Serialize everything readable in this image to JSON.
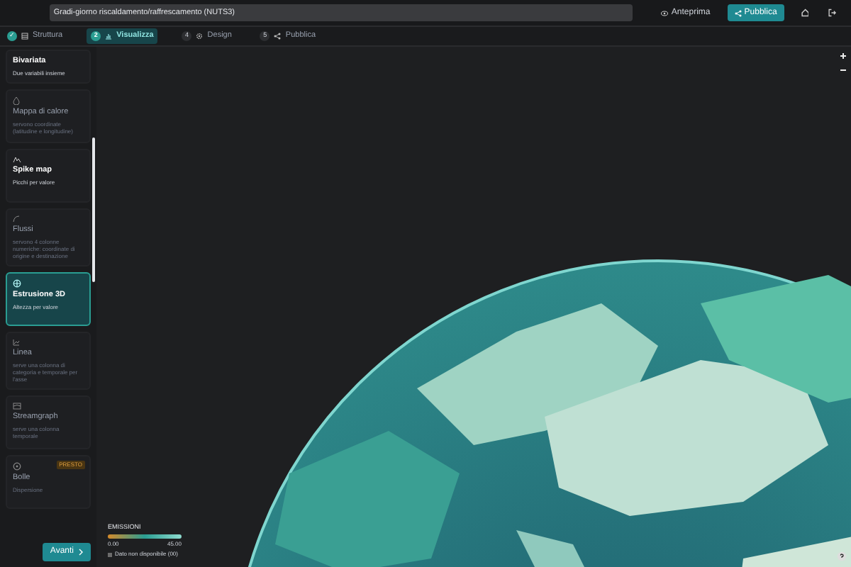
{
  "header": {
    "title_value": "Gradi-giorno riscaldamento/raffrescamento (NUTS3)",
    "preview_button": "Anteprima",
    "publish_button": "Pubblica"
  },
  "steps": [
    {
      "number": "✓",
      "label": "Struttura",
      "selected": false,
      "done": true
    },
    {
      "number": "2",
      "label": "Visualizza",
      "selected": true,
      "done": false
    },
    {
      "number": "4",
      "label": "Design",
      "selected": false,
      "done": false
    },
    {
      "number": "5",
      "label": "Pubblica",
      "selected": false,
      "done": false
    }
  ],
  "sidebar": {
    "cards": [
      {
        "title": "Bivariata",
        "description": "Due variabili insieme",
        "selected": false,
        "disabled": false
      },
      {
        "title": "Mappa di calore",
        "description": "servono coordinate (latitudine e longitudine)",
        "selected": false,
        "disabled": true
      },
      {
        "title": "Spike map",
        "description": "Picchi per valore",
        "selected": false,
        "disabled": false
      },
      {
        "title": "Flussi",
        "description": "servono 4 colonne numeriche: coordinate di origine e destinazione",
        "selected": false,
        "disabled": true
      },
      {
        "title": "Estrusione 3D",
        "description": "Altezza per valore",
        "selected": true,
        "disabled": false
      },
      {
        "title": "Linea",
        "description": "serve una colonna di categoria e temporale per l'asse",
        "selected": false,
        "disabled": true
      },
      {
        "title": "Streamgraph",
        "description": "serve una colonna temporale",
        "selected": false,
        "disabled": true
      },
      {
        "title": "Bolle",
        "description": "Dispersione",
        "badge": "PRESTO",
        "selected": false,
        "disabled": true
      }
    ],
    "next_button": "Avanti"
  },
  "legend": {
    "title": "EMISSIONI",
    "min": "0.00",
    "max": "45.00",
    "no_data": "Dato non disponibile (00)"
  }
}
